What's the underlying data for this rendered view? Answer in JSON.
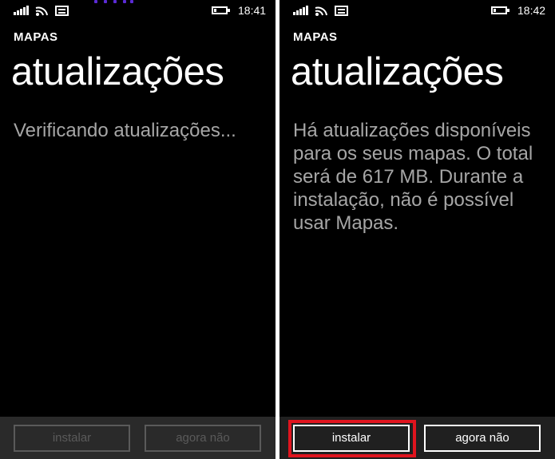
{
  "colors": {
    "screen_bg": "#000000",
    "text_primary": "#ffffff",
    "text_secondary": "#a6a6a6",
    "disabled": "#5a5a5a",
    "highlight": "#e0141e",
    "divider": "#ffffff"
  },
  "screens": [
    {
      "status": {
        "icons": [
          "signal-icon",
          "wifi-icon",
          "message-icon",
          "battery-icon"
        ],
        "time": "18:41"
      },
      "app_title": "MAPAS",
      "page_title": "atualizações",
      "body": "Verificando atualizações...",
      "buttons": [
        {
          "label": "instalar",
          "state": "disabled"
        },
        {
          "label": "agora não",
          "state": "disabled"
        }
      ]
    },
    {
      "status": {
        "icons": [
          "signal-icon",
          "wifi-icon",
          "message-icon",
          "battery-icon"
        ],
        "time": "18:42"
      },
      "app_title": "MAPAS",
      "page_title": "atualizações",
      "body": "Há atualizações disponíveis para os seus mapas. O total será de 617 MB. Durante a instalação, não é possível usar Mapas.",
      "buttons": [
        {
          "label": "instalar",
          "state": "enabled",
          "highlighted": true
        },
        {
          "label": "agora não",
          "state": "enabled"
        }
      ]
    }
  ]
}
